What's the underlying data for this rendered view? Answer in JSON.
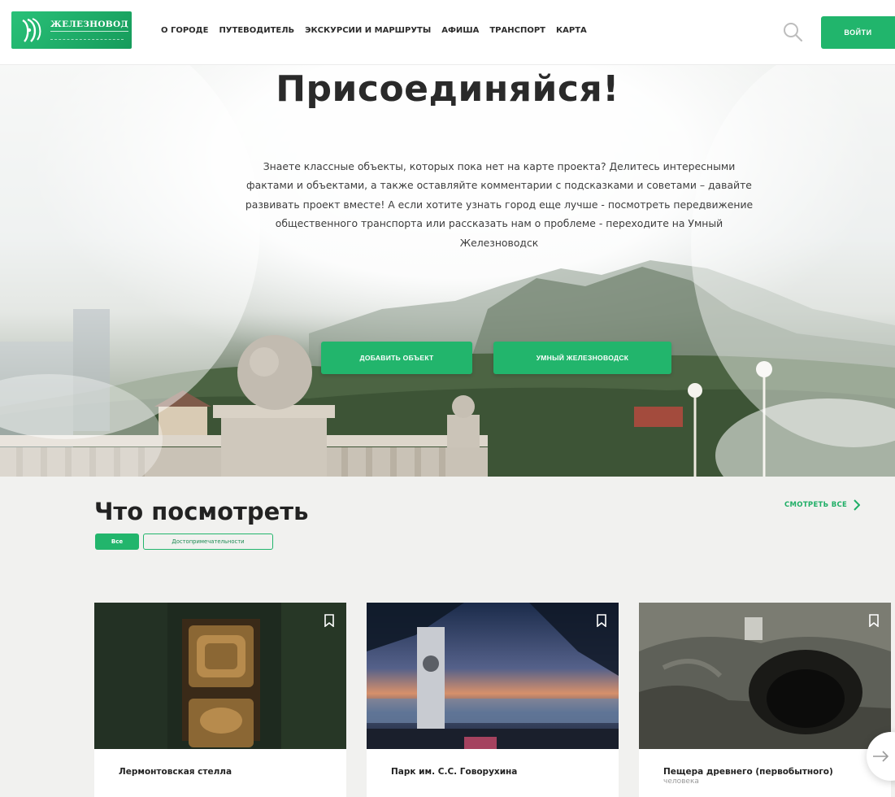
{
  "header": {
    "logo_text": "ЖЕЛЕЗНОВОДСК",
    "nav": [
      "О ГОРОДЕ",
      "ПУТЕВОДИТЕЛЬ",
      "ЭКСКУРСИИ И МАРШРУТЫ",
      "АФИША",
      "ТРАНСПОРТ",
      "КАРТА"
    ],
    "login_label": "ВОЙТИ",
    "search_icon": "search-icon"
  },
  "hero": {
    "title": "Присоединяйся!",
    "text": "Знаете классные объекты, которых пока нет на карте проекта? Делитесь интересными фактами и объектами, а также оставляйте комментарии с подсказками и советами – давайте развивать проект вместе! А если хотите узнать город еще лучше - посмотреть передвижение общественного транспорта или рассказать нам о проблеме - переходите на Умный Железноводск",
    "btn_add": "ДОБАВИТЬ ОБЪЕКТ",
    "btn_smart": "УМНЫЙ ЖЕЛЕЗНОВОДСК"
  },
  "section": {
    "title": "Что посмотреть",
    "see_all": "СМОТРЕТЬ ВСЕ",
    "filters": [
      "Все",
      "Достопримечательности"
    ]
  },
  "cards": [
    {
      "title": "Лермонтовская стелла",
      "subtitle": ""
    },
    {
      "title": "Парк им. С.С. Говорухина",
      "subtitle": ""
    },
    {
      "title": "Пещера древнего (первобытного)",
      "subtitle": "человека"
    }
  ],
  "colors": {
    "brand_green": "#22b56c",
    "text_dark": "#2a2a2a",
    "page_bg": "#f1f1ef"
  }
}
